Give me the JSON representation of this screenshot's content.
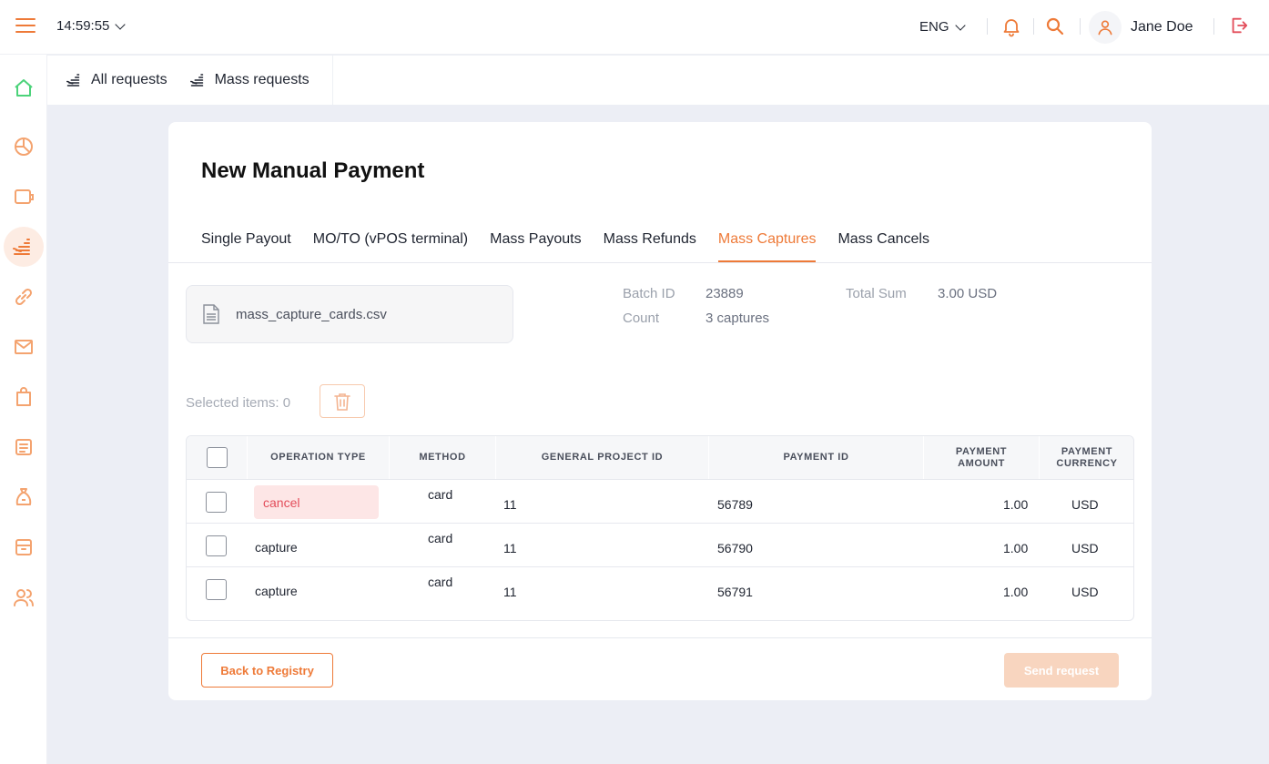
{
  "colors": {
    "accent": "#ee7a38",
    "active_home": "#4cd37a",
    "cancel_bg": "#fde6e6",
    "cancel_text": "#e34e5b"
  },
  "header": {
    "time": "14:59:55",
    "language": "ENG",
    "user_name": "Jane Doe"
  },
  "sidebar": {
    "icons": [
      "home-icon",
      "pie-chart-icon",
      "wallet-icon",
      "payouts-icon",
      "link-icon",
      "mail-icon",
      "bag-icon",
      "document-icon",
      "money-bag-icon",
      "archive-icon",
      "users-icon"
    ]
  },
  "subnav": {
    "tabs": [
      {
        "label": "All requests"
      },
      {
        "label": "Mass requests"
      }
    ]
  },
  "page": {
    "title": "New Manual Payment",
    "tabs": [
      {
        "label": "Single Payout"
      },
      {
        "label": "MO/TO (vPOS terminal)"
      },
      {
        "label": "Mass Payouts"
      },
      {
        "label": "Mass Refunds"
      },
      {
        "label": "Mass Captures",
        "active": true
      },
      {
        "label": "Mass Cancels"
      }
    ],
    "file_name": "mass_capture_cards.csv",
    "batch": {
      "batch_id_label": "Batch ID",
      "batch_id": "23889",
      "count_label": "Count",
      "count": "3 captures",
      "total_label": "Total Sum",
      "total": "3.00 USD"
    },
    "selected_items": "Selected items: 0",
    "table": {
      "headers": {
        "operation_type": "OPERATION TYPE",
        "method": "METHOD",
        "project_id": "GENERAL PROJECT ID",
        "payment_id": "PAYMENT ID",
        "amount_1": "PAYMENT",
        "amount_2": "AMOUNT",
        "currency_1": "PAYMENT",
        "currency_2": "CURRENCY"
      },
      "rows": [
        {
          "operation_type": "cancel",
          "method": "card",
          "project_id": "11",
          "payment_id": "56789",
          "amount": "1.00",
          "currency": "USD"
        },
        {
          "operation_type": "capture",
          "method": "card",
          "project_id": "11",
          "payment_id": "56790",
          "amount": "1.00",
          "currency": "USD"
        },
        {
          "operation_type": "capture",
          "method": "card",
          "project_id": "11",
          "payment_id": "56791",
          "amount": "1.00",
          "currency": "USD"
        }
      ]
    },
    "buttons": {
      "back": "Back to Registry",
      "send": "Send request"
    }
  }
}
